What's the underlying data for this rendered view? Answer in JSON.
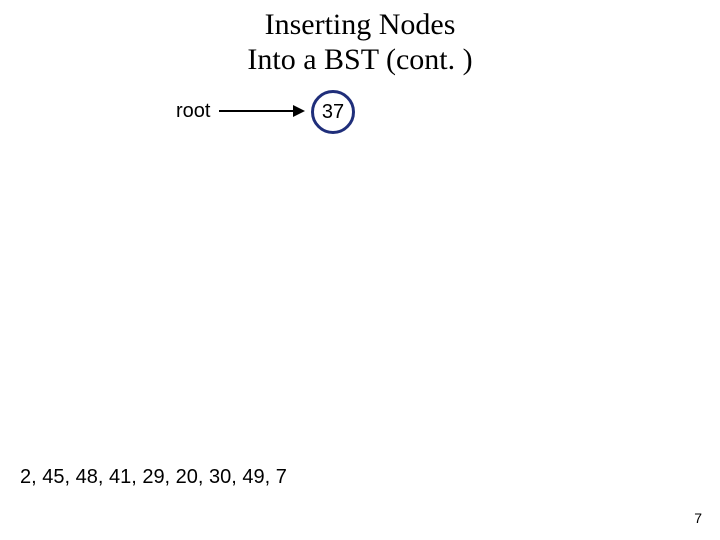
{
  "title_line1": "Inserting Nodes",
  "title_line2": "Into a BST (cont. )",
  "root_label": "root",
  "node_value": "37",
  "sequence_text": "2, 45, 48, 41, 29, 20, 30, 49, 7",
  "page_number": "7",
  "chart_data": {
    "type": "diagram",
    "description": "Binary search tree insertion illustration",
    "root_value": 37,
    "pending_insertions": [
      2,
      45,
      48,
      41,
      29,
      20,
      30,
      49,
      7
    ]
  }
}
